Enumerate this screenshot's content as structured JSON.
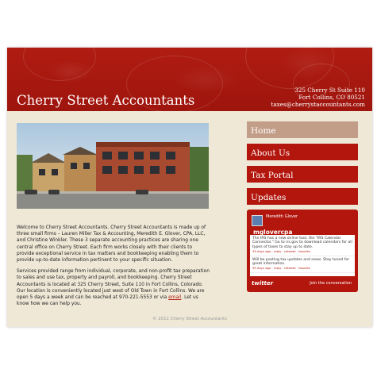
{
  "header": {
    "title": "Cherry Street Accountants",
    "address_line1": "325 Cherry St Suite 110",
    "address_line2": "Fort Collins, CO 80521",
    "email": "taxes@cherrystaccountants.com"
  },
  "nav": [
    {
      "label": "Home",
      "active": true
    },
    {
      "label": "About Us",
      "active": false
    },
    {
      "label": "Tax Portal",
      "active": false
    },
    {
      "label": "Updates",
      "active": false
    }
  ],
  "main": {
    "paragraph1": "Welcome to Cherry Street Accountants. Cherry Street Accountants is made up of three small firms – Lauren Miller Tax & Accounting, Meredith E. Glover, CPA, LLC, and Christine Winkler. These 3 separate accounting practices are sharing one central office on Cherry Street. Each firm works closely with their clients to provide exceptional service in tax matters and bookkeeping enabling them to provide up-to-date information pertinent to your specific situation.",
    "paragraph2_a": "Services provided range from individual, corporate, and non-profit tax preparation to sales and use tax, property and payroll, and bookkeeping. Cherry Street Accountants is located at 325 Cherry Street, Suite 110 in Fort Collins, Colorado. Our location is conveniently located just west of Old Town in Fort Collins. We are open 5 days a week and can be reached at 970-221-5553 or via ",
    "email_link": "email",
    "paragraph2_b": ". Let us know how we can help you."
  },
  "twitter": {
    "name": "Meredith Glover",
    "username": "mglovercpa",
    "tweets": [
      {
        "text": "The IRS has a new online tool, the \"IRS Calendar Connector.\" Go to irs.gov to download calendars for all types of taxes to stay up to date.",
        "meta": "39 days ago · reply · retweet · favorite"
      },
      {
        "text": "Will be posting tax updates and news. Stay tuned for great information.",
        "meta": "95 days ago · reply · retweet · favorite"
      }
    ],
    "logo": "twitter",
    "join": "Join the conversation"
  },
  "footer": "© 2011 Cherry Street Accountants"
}
